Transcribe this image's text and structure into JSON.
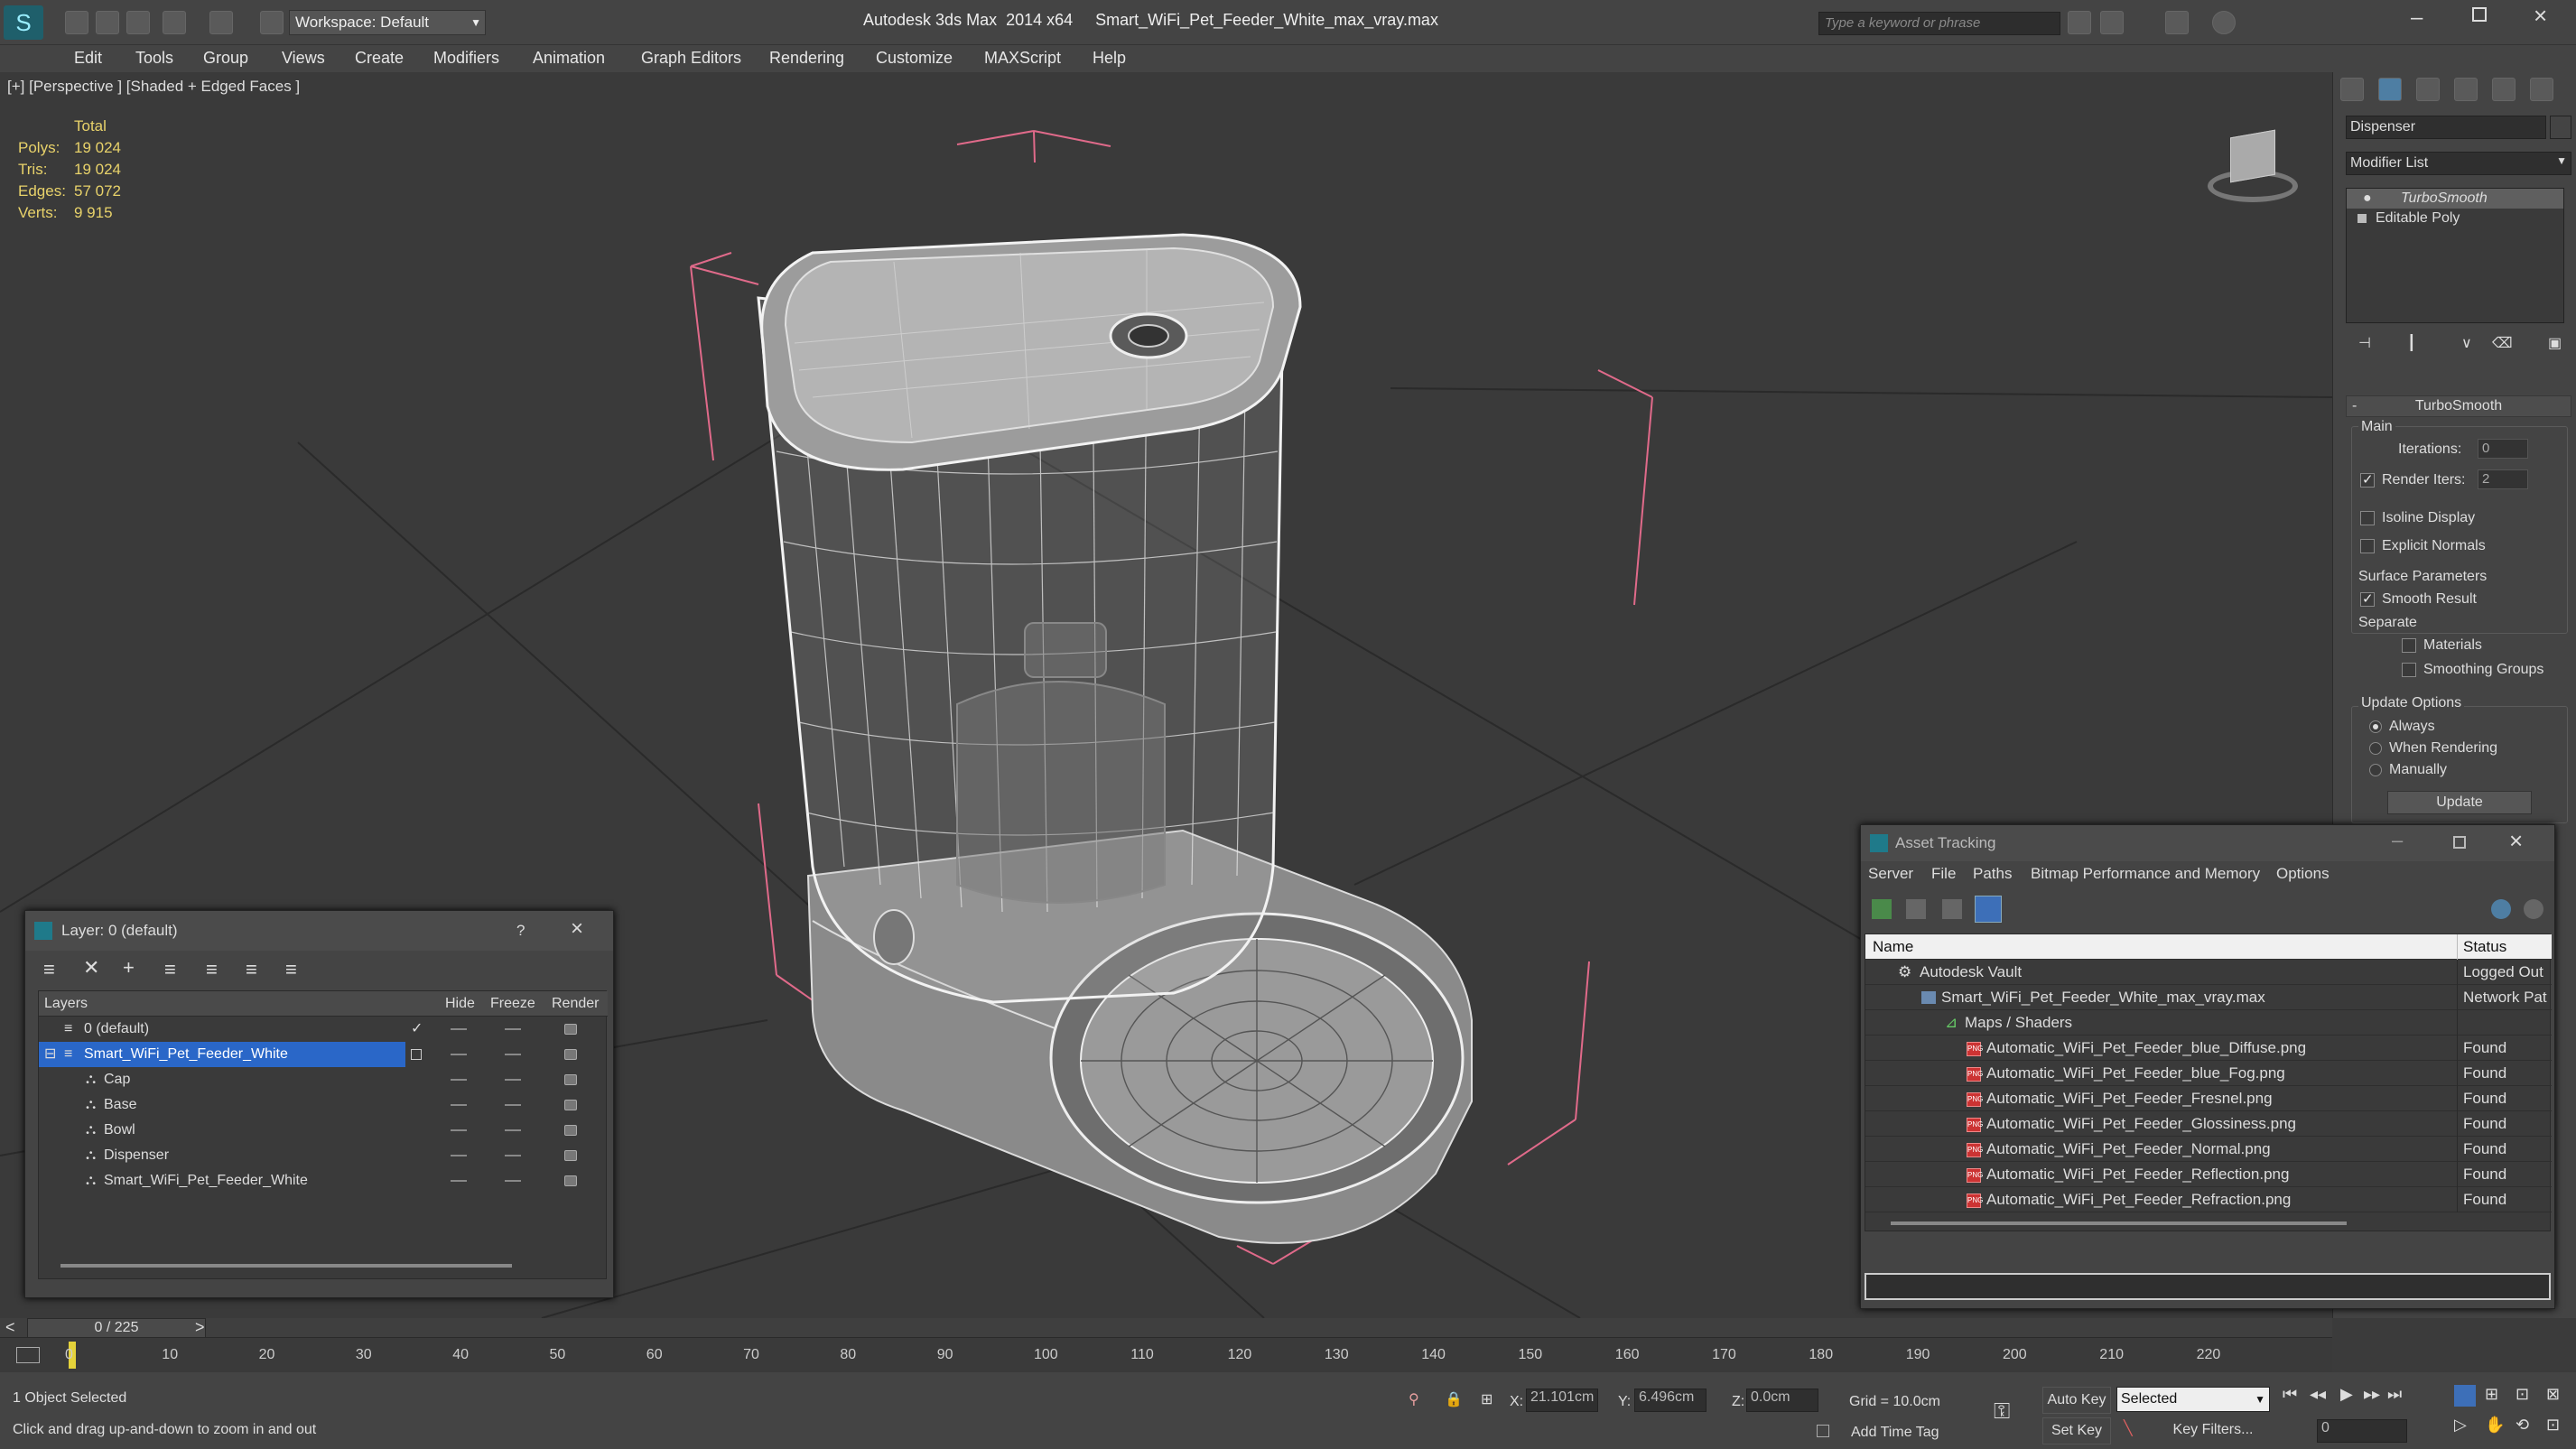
{
  "app": {
    "title": "Autodesk 3ds Max  2014 x64     Smart_WiFi_Pet_Feeder_White_max_vray.max",
    "workspace": "Workspace: Default",
    "search_placeholder": "Type a keyword or phrase"
  },
  "menu": [
    "Edit",
    "Tools",
    "Group",
    "Views",
    "Create",
    "Modifiers",
    "Animation",
    "Graph Editors",
    "Rendering",
    "Customize",
    "MAXScript",
    "Help"
  ],
  "viewport": {
    "label": "[+] [Perspective ] [Shaded + Edged Faces ]",
    "stats": {
      "total_label": "Total",
      "rows": [
        {
          "label": "Polys:",
          "value": "19 024"
        },
        {
          "label": "Tris:",
          "value": "19 024"
        },
        {
          "label": "Edges:",
          "value": "57 072"
        },
        {
          "label": "Verts:",
          "value": "9 915"
        }
      ]
    }
  },
  "command_panel": {
    "object_name": "Dispenser",
    "modifier_list": "Modifier List",
    "stack": [
      "TurboSmooth",
      "Editable Poly"
    ],
    "rollout_title": "TurboSmooth",
    "main_label": "Main",
    "iterations_label": "Iterations:",
    "iterations_value": "0",
    "render_iters_label": "Render Iters:",
    "render_iters_value": "2",
    "isoline_label": "Isoline Display",
    "explicit_label": "Explicit Normals",
    "surface_label": "Surface Parameters",
    "smooth_label": "Smooth Result",
    "separate_label": "Separate",
    "materials_label": "Materials",
    "smoothing_label": "Smoothing Groups",
    "update_label": "Update Options",
    "always_label": "Always",
    "when_label": "When Rendering",
    "manually_label": "Manually",
    "update_button": "Update"
  },
  "layer_dialog": {
    "title": "Layer: 0 (default)",
    "help": "?",
    "columns": [
      "Layers",
      "Hide",
      "Freeze",
      "Render"
    ],
    "rows": [
      {
        "name": "0 (default)",
        "indent": 0
      },
      {
        "name": "Smart_WiFi_Pet_Feeder_White",
        "indent": 0
      },
      {
        "name": "Cap",
        "indent": 1
      },
      {
        "name": "Base",
        "indent": 1
      },
      {
        "name": "Bowl",
        "indent": 1
      },
      {
        "name": "Dispenser",
        "indent": 1
      },
      {
        "name": "Smart_WiFi_Pet_Feeder_White",
        "indent": 1
      }
    ]
  },
  "asset_tracking": {
    "title": "Asset Tracking",
    "menu": [
      "Server",
      "File",
      "Paths",
      "Bitmap Performance and Memory",
      "Options"
    ],
    "columns": [
      "Name",
      "Status"
    ],
    "rows": [
      {
        "name": "Autodesk Vault",
        "status": "Logged Out",
        "indent": 0
      },
      {
        "name": "Smart_WiFi_Pet_Feeder_White_max_vray.max",
        "status": "Network Pat",
        "indent": 1
      },
      {
        "name": "Maps / Shaders",
        "status": "",
        "indent": 2
      },
      {
        "name": "Automatic_WiFi_Pet_Feeder_blue_Diffuse.png",
        "status": "Found",
        "indent": 3
      },
      {
        "name": "Automatic_WiFi_Pet_Feeder_blue_Fog.png",
        "status": "Found",
        "indent": 3
      },
      {
        "name": "Automatic_WiFi_Pet_Feeder_Fresnel.png",
        "status": "Found",
        "indent": 3
      },
      {
        "name": "Automatic_WiFi_Pet_Feeder_Glossiness.png",
        "status": "Found",
        "indent": 3
      },
      {
        "name": "Automatic_WiFi_Pet_Feeder_Normal.png",
        "status": "Found",
        "indent": 3
      },
      {
        "name": "Automatic_WiFi_Pet_Feeder_Reflection.png",
        "status": "Found",
        "indent": 3
      },
      {
        "name": "Automatic_WiFi_Pet_Feeder_Refraction.png",
        "status": "Found",
        "indent": 3
      }
    ]
  },
  "timeline": {
    "frame": "0 / 225",
    "ticks": [
      "0",
      "10",
      "20",
      "30",
      "40",
      "50",
      "60",
      "70",
      "80",
      "90",
      "100",
      "110",
      "120",
      "130",
      "140",
      "150",
      "160",
      "170",
      "180",
      "190",
      "200",
      "210",
      "220"
    ]
  },
  "status": {
    "selection": "1 Object Selected",
    "hint": "Click and drag up-and-down to zoom in and out",
    "x_label": "X:",
    "x_value": "21.101cm",
    "y_label": "Y:",
    "y_value": "6.496cm",
    "z_label": "Z:",
    "z_value": "0.0cm",
    "grid": "Grid = 10.0cm",
    "add_time_tag": "Add Time Tag",
    "auto_key": "Auto Key",
    "set_key": "Set Key",
    "selected": "Selected",
    "key_filters": "Key Filters...",
    "frame_field": "0"
  }
}
